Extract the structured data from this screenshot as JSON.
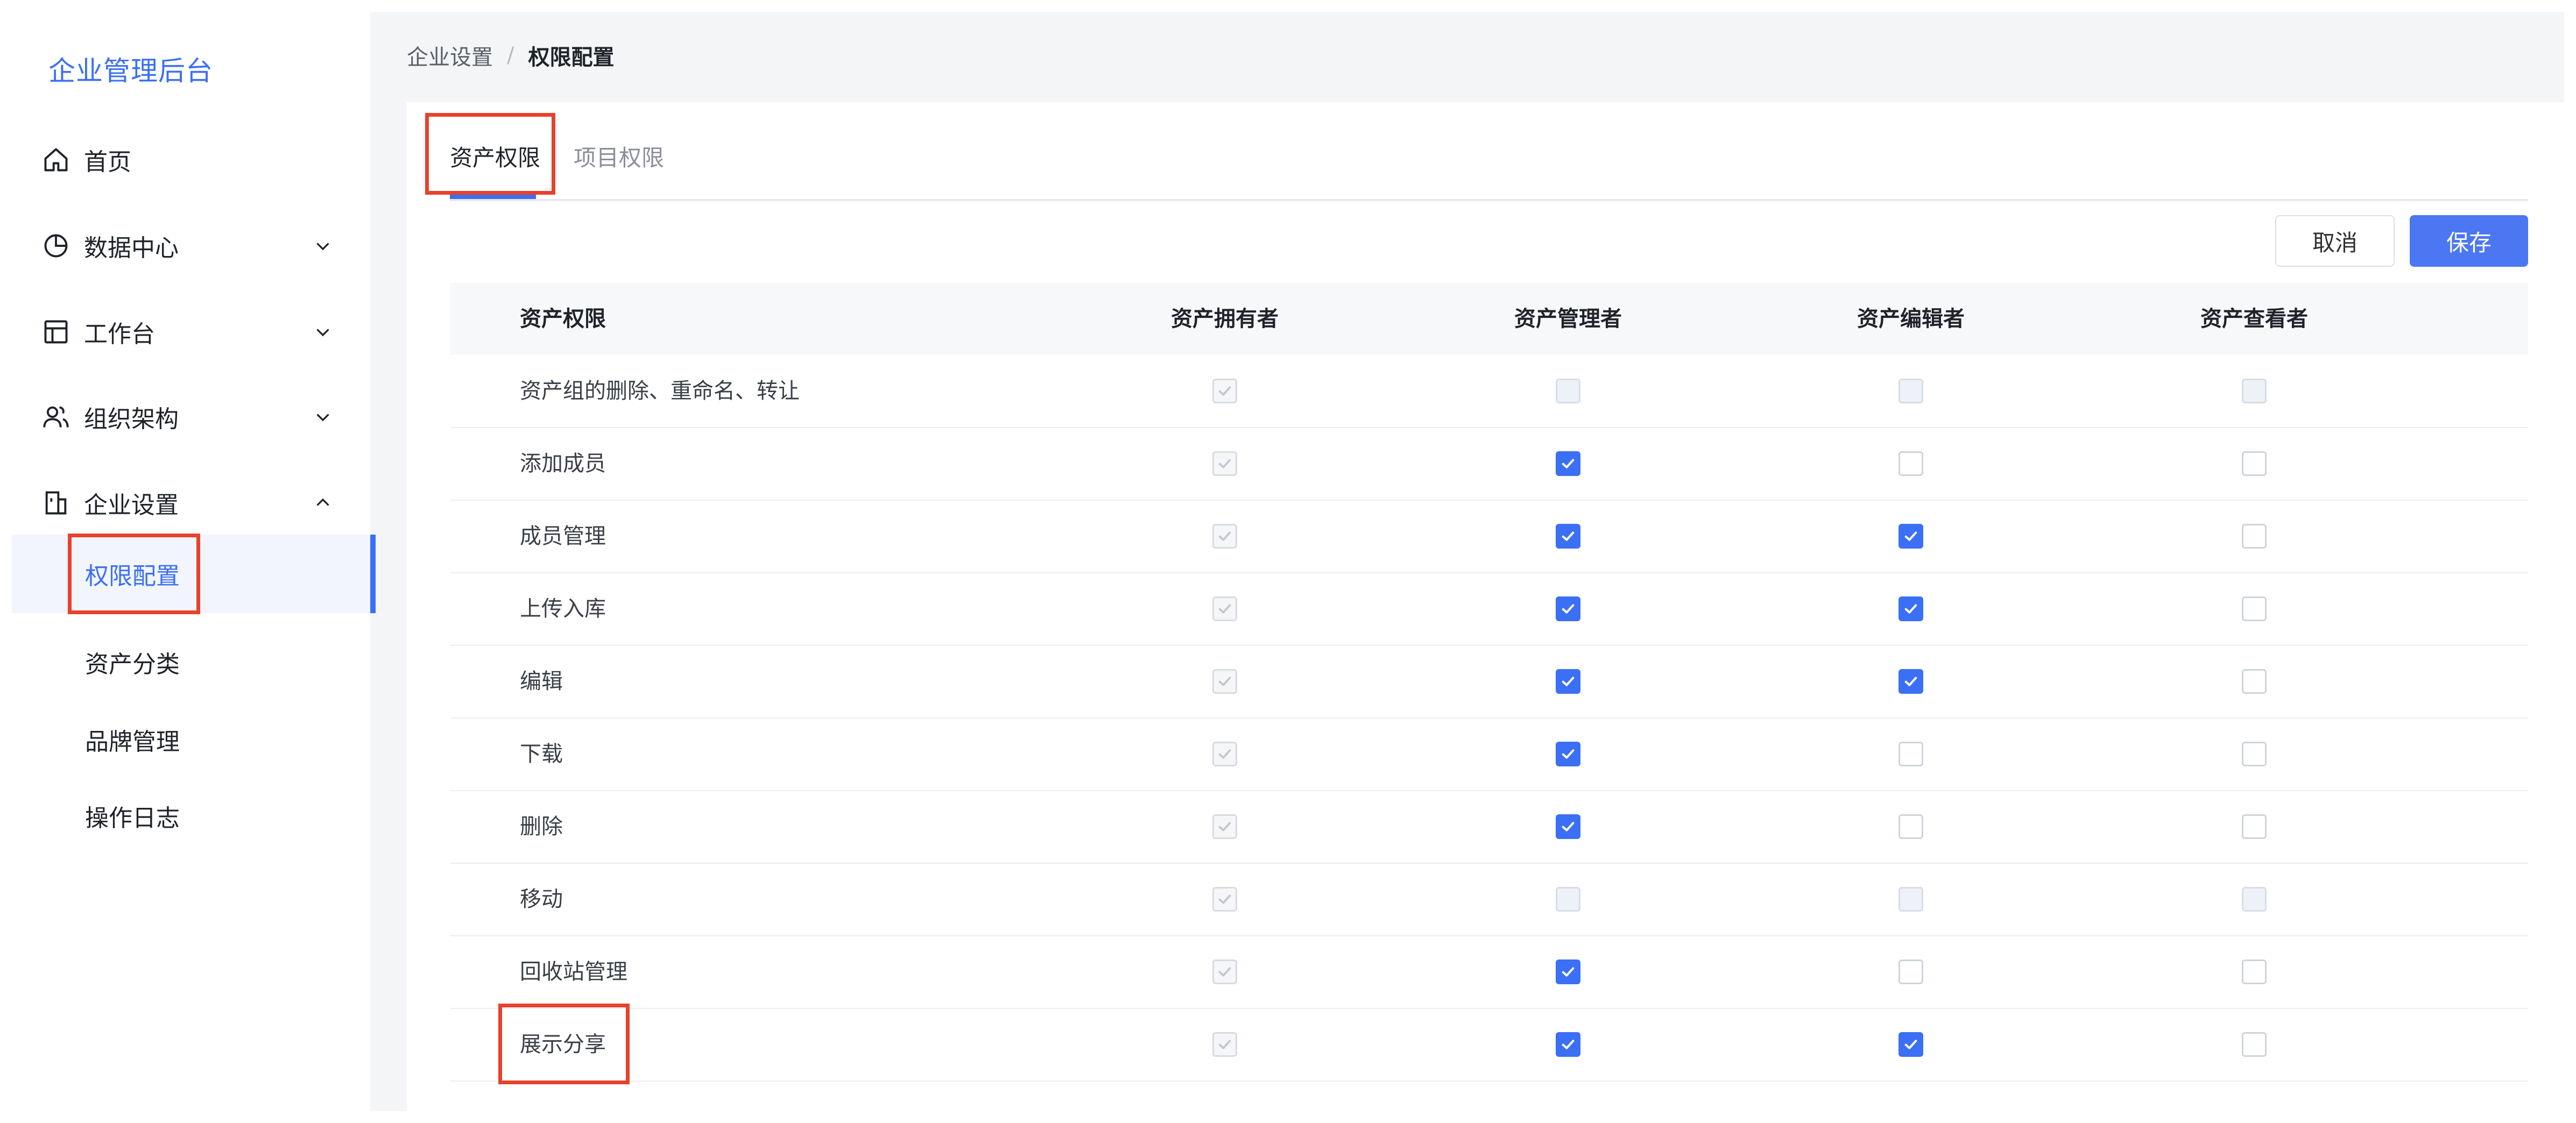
{
  "app": {
    "title": "企业管理后台"
  },
  "colors": {
    "accent": "#3b6ff5",
    "highlight": "#e8412c"
  },
  "sidebar": {
    "items": [
      {
        "label": "首页",
        "icon": "home-icon",
        "expandable": false
      },
      {
        "label": "数据中心",
        "icon": "pie-chart-icon",
        "expandable": true,
        "expanded": false
      },
      {
        "label": "工作台",
        "icon": "layout-icon",
        "expandable": true,
        "expanded": false
      },
      {
        "label": "组织架构",
        "icon": "users-icon",
        "expandable": true,
        "expanded": false
      },
      {
        "label": "企业设置",
        "icon": "building-icon",
        "expandable": true,
        "expanded": true
      }
    ],
    "subitems": [
      {
        "label": "权限配置",
        "active": true
      },
      {
        "label": "资产分类",
        "active": false
      },
      {
        "label": "品牌管理",
        "active": false
      },
      {
        "label": "操作日志",
        "active": false
      }
    ]
  },
  "breadcrumb": {
    "items": [
      "企业设置",
      "权限配置"
    ],
    "separator": "/"
  },
  "tabs": [
    {
      "label": "资产权限",
      "active": true
    },
    {
      "label": "项目权限",
      "active": false
    }
  ],
  "actions": {
    "cancel_label": "取消",
    "save_label": "保存"
  },
  "table": {
    "columns": [
      "资产权限",
      "资产拥有者",
      "资产管理者",
      "资产编辑者",
      "资产查看者"
    ],
    "rows": [
      {
        "label": "资产组的删除、重命名、转让",
        "cells": [
          "disabled-checked",
          "disabled",
          "disabled",
          "disabled"
        ]
      },
      {
        "label": "添加成员",
        "cells": [
          "disabled-checked",
          "checked",
          "unchecked",
          "unchecked"
        ]
      },
      {
        "label": "成员管理",
        "cells": [
          "disabled-checked",
          "checked",
          "checked",
          "unchecked"
        ]
      },
      {
        "label": "上传入库",
        "cells": [
          "disabled-checked",
          "checked",
          "checked",
          "unchecked"
        ]
      },
      {
        "label": "编辑",
        "cells": [
          "disabled-checked",
          "checked",
          "checked",
          "unchecked"
        ]
      },
      {
        "label": "下载",
        "cells": [
          "disabled-checked",
          "checked",
          "unchecked",
          "unchecked"
        ]
      },
      {
        "label": "删除",
        "cells": [
          "disabled-checked",
          "checked",
          "unchecked",
          "unchecked"
        ]
      },
      {
        "label": "移动",
        "cells": [
          "disabled-checked",
          "disabled",
          "disabled",
          "disabled"
        ]
      },
      {
        "label": "回收站管理",
        "cells": [
          "disabled-checked",
          "checked",
          "unchecked",
          "unchecked"
        ]
      },
      {
        "label": "展示分享",
        "cells": [
          "disabled-checked",
          "checked",
          "checked",
          "unchecked"
        ]
      }
    ]
  }
}
